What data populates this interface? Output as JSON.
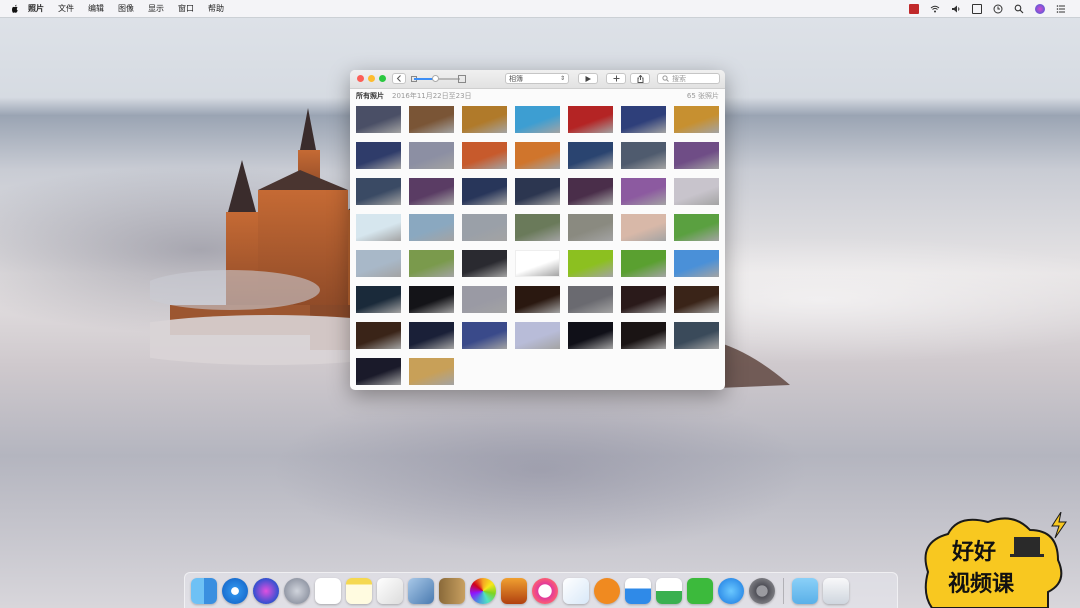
{
  "menubar": {
    "items": [
      "照片",
      "文件",
      "编辑",
      "图像",
      "显示",
      "窗口",
      "帮助"
    ]
  },
  "window": {
    "sort_select": "相簿",
    "search_placeholder": "搜索",
    "section_title": "所有照片",
    "date_range": "2016年11月22日至23日",
    "photo_count": "65 张照片",
    "zoom_level": 0.45
  },
  "thumbnails": [
    "#4a4f66",
    "#7a5536",
    "#b07a2a",
    "#3d9ed2",
    "#b42424",
    "#2e3f7a",
    "#c79030",
    "#2f3c6a",
    "#8c8fa3",
    "#c75a2c",
    "#d0752c",
    "#2a4470",
    "#4f5b6e",
    "#6f4d86",
    "#3a4a64",
    "#5a3c64",
    "#28365a",
    "#2c3650",
    "#4a2e4a",
    "#8c5aa0",
    "#c8c4cc",
    "#d6e6ee",
    "#8aa8c0",
    "#9aa0a8",
    "#6a7a5a",
    "#8a8a80",
    "#d8b8a8",
    "#5aa040",
    "#a8b8c8",
    "#7a9a4c",
    "#2a2a30",
    "#ffffff",
    "#8cc020",
    "#5aa030",
    "#4a90d8",
    "#1a2a3a",
    "#141418",
    "#9a9aa4",
    "#2a1810",
    "#6a6a70",
    "#2a1a1a",
    "#3a2418",
    "#3a2418",
    "#1a2038",
    "#3a4a8a",
    "#b8bcd8",
    "#101018",
    "#1a1414",
    "#3a4a5a",
    "#1a1a2a",
    "#c8a058"
  ],
  "dock": {
    "icons": [
      "finder-icon",
      "safari-icon",
      "siri-icon",
      "launchpad-icon",
      "reminders-icon",
      "notes-icon",
      "textedit-icon",
      "preview-icon",
      "contacts-icon",
      "photos-icon",
      "garageband-icon",
      "itunes-icon",
      "pages-icon",
      "ibooks-icon",
      "keynote-icon",
      "numbers-icon",
      "facetime-icon",
      "appstore-icon",
      "system-preferences-icon",
      "downloads-folder-icon",
      "trash-icon"
    ]
  },
  "watermark": {
    "line1": "好好",
    "line2": "视频课"
  }
}
